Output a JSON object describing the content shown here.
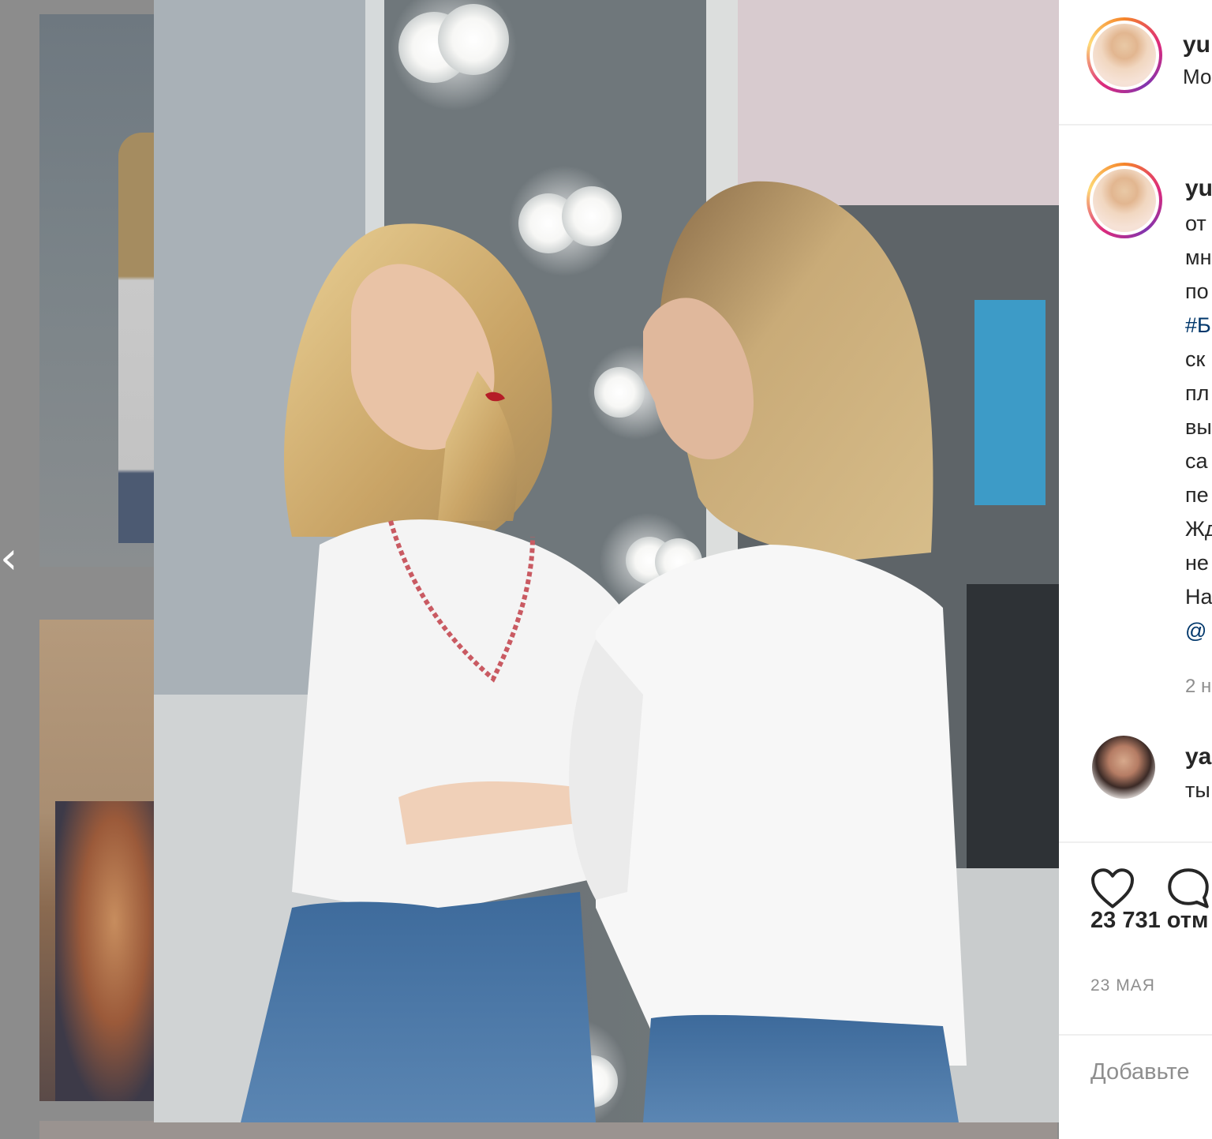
{
  "post": {
    "username": "yu",
    "location": "Мо",
    "caption": {
      "username": "yu",
      "lines": [
        "от",
        "мн",
        "по",
        "#Б",
        "ск",
        "пл",
        "вы",
        "са",
        "пе",
        "Жд",
        "не",
        "На",
        "@"
      ],
      "time": "2 н"
    },
    "comment": {
      "username": "ya",
      "text": "ты"
    },
    "likes_text": "23 731 отм",
    "date": "23 МАЯ",
    "add_comment_placeholder": "Добавьте"
  },
  "icons": {
    "prev": "chevron-left-icon",
    "like": "heart-icon",
    "comment": "comment-icon"
  },
  "colors": {
    "text": "#262626",
    "muted": "#8e8e8e",
    "link": "#00376b",
    "backdrop": "#8c8c8c"
  }
}
